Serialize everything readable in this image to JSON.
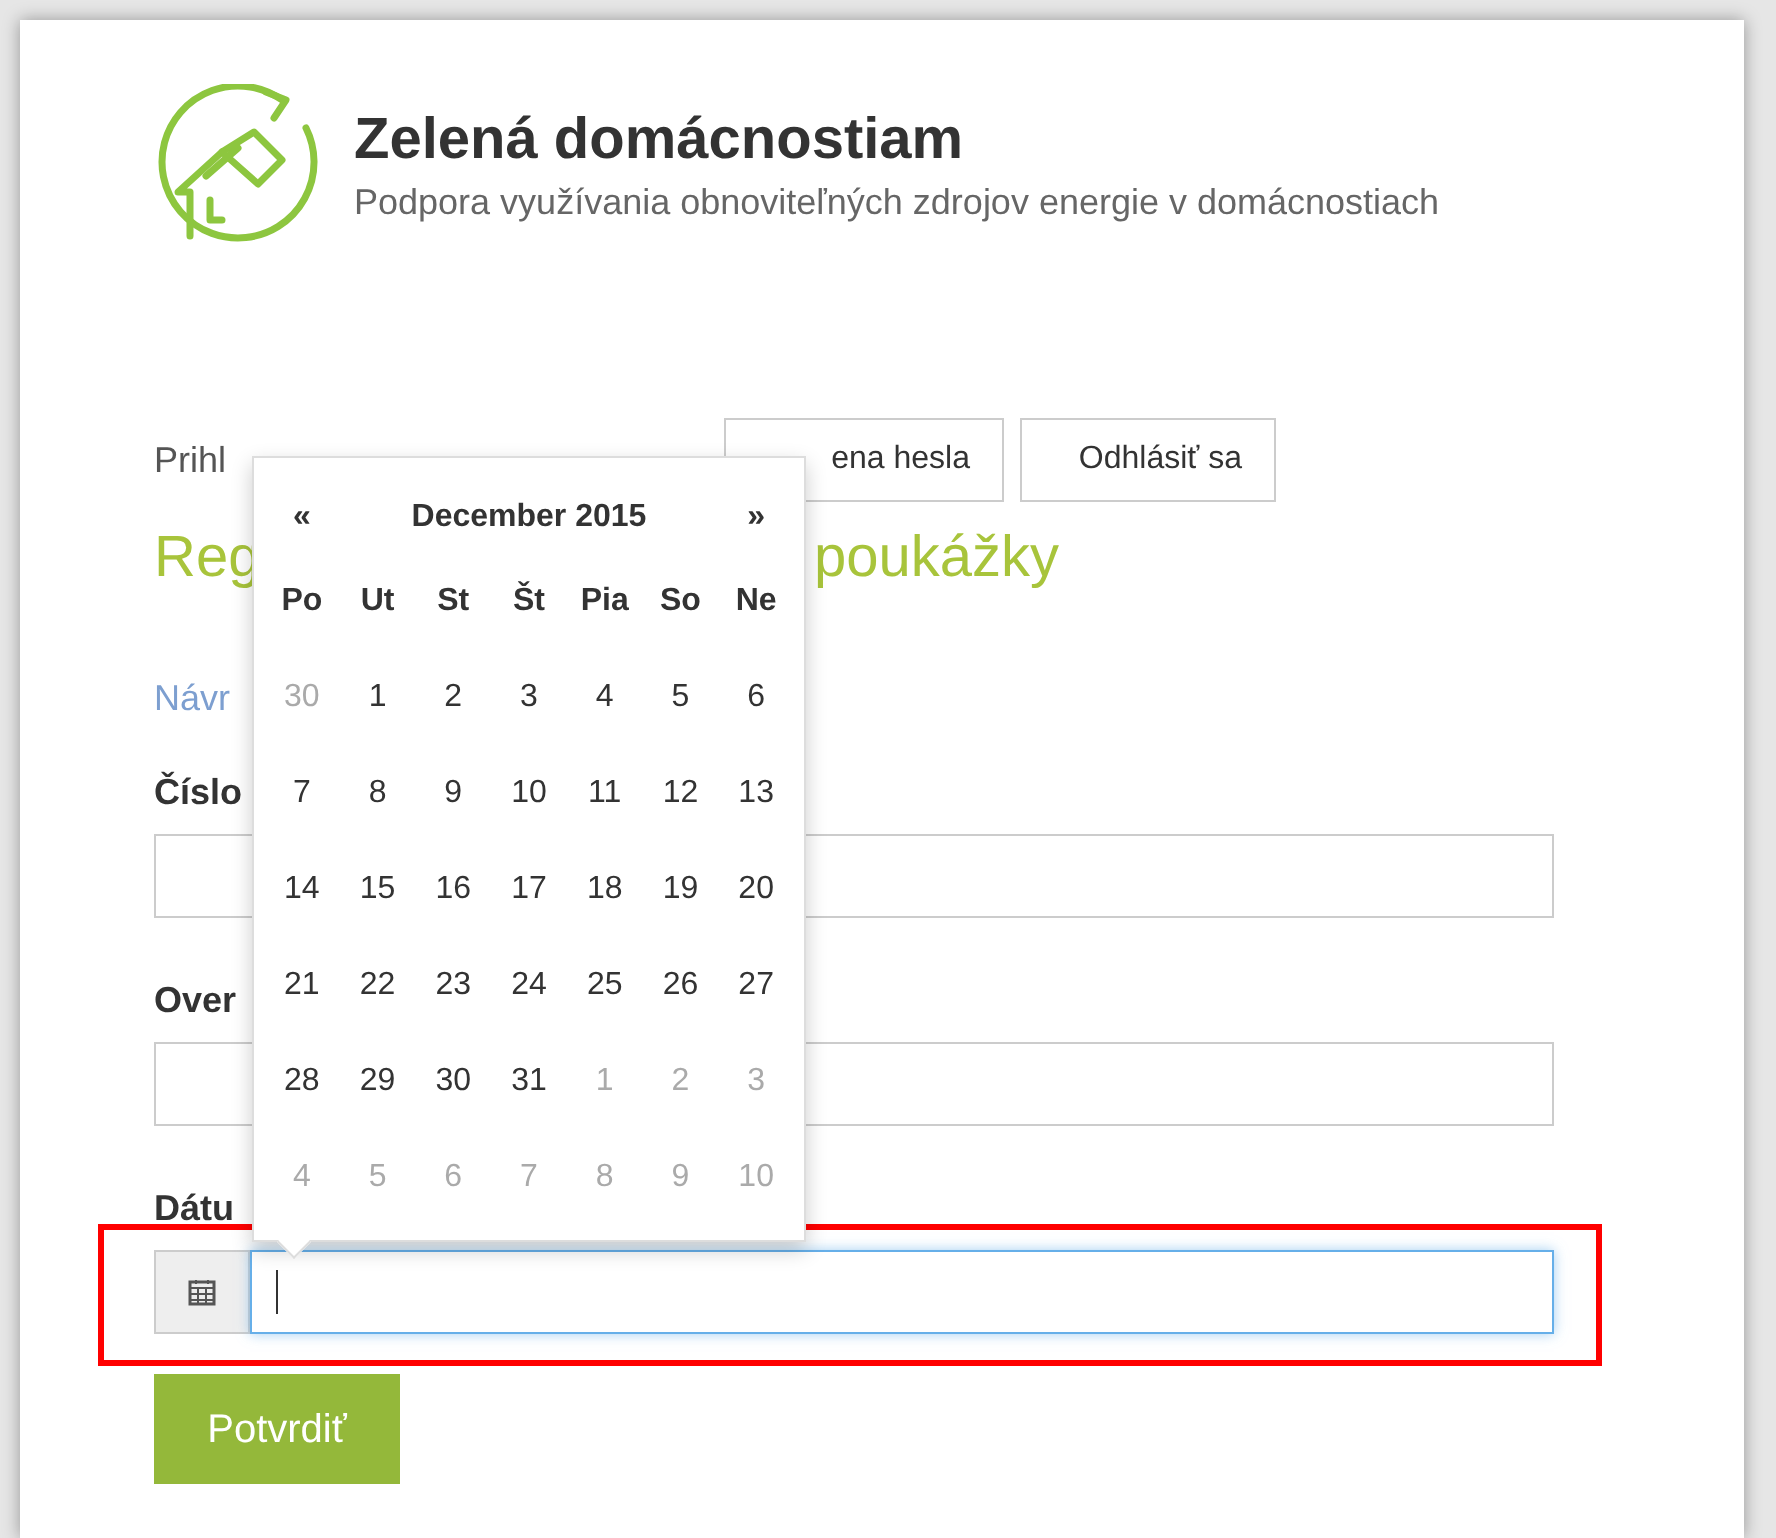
{
  "header": {
    "title": "Zelená domácnostiam",
    "subtitle": "Podpora využívania obnoviteľných zdrojov energie v domácnostiach"
  },
  "login": {
    "text": "Prihl",
    "buttons": [
      "ena hesla",
      "Odhlásiť sa"
    ]
  },
  "heading": {
    "parts": [
      "Reg",
      "poukážky"
    ]
  },
  "link": "Návr",
  "fields": [
    {
      "label": "Číslo",
      "kind": "text"
    },
    {
      "label": "Over",
      "kind": "text"
    },
    {
      "label": "Dátu",
      "kind": "date",
      "focused": true
    }
  ],
  "submit": "Potvrdiť",
  "datepicker": {
    "prev": "«",
    "month": "December 2015",
    "next": "»",
    "weekdays": [
      "Po",
      "Ut",
      "St",
      "Št",
      "Pia",
      "So",
      "Ne"
    ],
    "weeks": [
      [
        {
          "day": "30",
          "muted": true
        },
        {
          "day": "1",
          "muted": false
        },
        {
          "day": "2",
          "muted": false
        },
        {
          "day": "3",
          "muted": false
        },
        {
          "day": "4",
          "muted": false
        },
        {
          "day": "5",
          "muted": false
        },
        {
          "day": "6",
          "muted": false
        }
      ],
      [
        {
          "day": "7",
          "muted": false
        },
        {
          "day": "8",
          "muted": false
        },
        {
          "day": "9",
          "muted": false
        },
        {
          "day": "10",
          "muted": false
        },
        {
          "day": "11",
          "muted": false
        },
        {
          "day": "12",
          "muted": false
        },
        {
          "day": "13",
          "muted": false
        }
      ],
      [
        {
          "day": "14",
          "muted": false
        },
        {
          "day": "15",
          "muted": false
        },
        {
          "day": "16",
          "muted": false
        },
        {
          "day": "17",
          "muted": false
        },
        {
          "day": "18",
          "muted": false
        },
        {
          "day": "19",
          "muted": false
        },
        {
          "day": "20",
          "muted": false
        }
      ],
      [
        {
          "day": "21",
          "muted": false
        },
        {
          "day": "22",
          "muted": false
        },
        {
          "day": "23",
          "muted": false
        },
        {
          "day": "24",
          "muted": false
        },
        {
          "day": "25",
          "muted": false
        },
        {
          "day": "26",
          "muted": false
        },
        {
          "day": "27",
          "muted": false
        }
      ],
      [
        {
          "day": "28",
          "muted": false
        },
        {
          "day": "29",
          "muted": false
        },
        {
          "day": "30",
          "muted": false
        },
        {
          "day": "31",
          "muted": false
        },
        {
          "day": "1",
          "muted": true
        },
        {
          "day": "2",
          "muted": true
        },
        {
          "day": "3",
          "muted": true
        }
      ],
      [
        {
          "day": "4",
          "muted": true
        },
        {
          "day": "5",
          "muted": true
        },
        {
          "day": "6",
          "muted": true
        },
        {
          "day": "7",
          "muted": true
        },
        {
          "day": "8",
          "muted": true
        },
        {
          "day": "9",
          "muted": true
        },
        {
          "day": "10",
          "muted": true
        }
      ]
    ]
  }
}
